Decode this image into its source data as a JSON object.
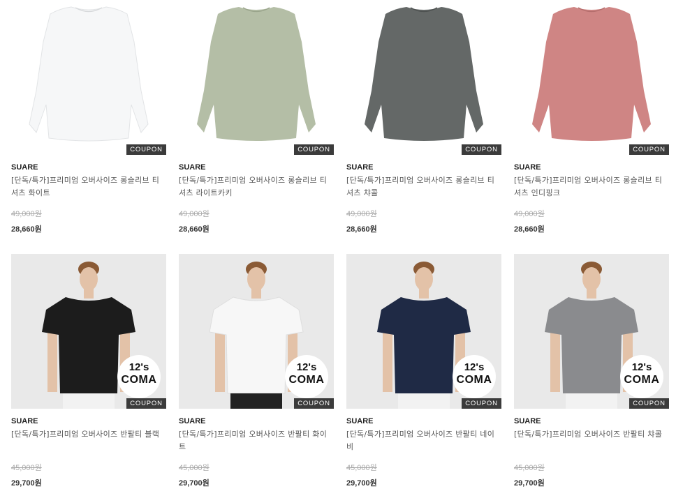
{
  "products": [
    {
      "brand": "SUARE",
      "name": "[단독/특가]프리미엄 오버사이즈 롱슬리브 티셔츠 화이트",
      "original_price": "49,000원",
      "sale_price": "28,660원",
      "coupon": "COUPON",
      "color": "#f6f7f8",
      "type": "longsleeve"
    },
    {
      "brand": "SUARE",
      "name": "[단독/특가]프리미엄 오버사이즈 롱슬리브 티셔츠 라이트카키",
      "original_price": "49,000원",
      "sale_price": "28,660원",
      "coupon": "COUPON",
      "color": "#b4bea6",
      "type": "longsleeve"
    },
    {
      "brand": "SUARE",
      "name": "[단독/특가]프리미엄 오버사이즈 롱슬리브 티셔츠 챠콜",
      "original_price": "49,000원",
      "sale_price": "28,660원",
      "coupon": "COUPON",
      "color": "#646867",
      "type": "longsleeve"
    },
    {
      "brand": "SUARE",
      "name": "[단독/특가]프리미엄 오버사이즈 롱슬리브 티셔츠 인디핑크",
      "original_price": "49,000원",
      "sale_price": "28,660원",
      "coupon": "COUPON",
      "color": "#cf8584",
      "type": "longsleeve"
    },
    {
      "brand": "SUARE",
      "name": "[단독/특가]프리미엄 오버사이즈 반팔티 블랙",
      "original_price": "45,000원",
      "sale_price": "29,700원",
      "coupon": "COUPON",
      "badge_line1": "12's",
      "badge_line2": "COMA",
      "color": "#1c1c1c",
      "type": "shortsleeve"
    },
    {
      "brand": "SUARE",
      "name": "[단독/특가]프리미엄 오버사이즈 반팔티 화이트",
      "original_price": "45,000원",
      "sale_price": "29,700원",
      "coupon": "COUPON",
      "badge_line1": "12's",
      "badge_line2": "COMA",
      "color": "#f7f7f7",
      "type": "shortsleeve"
    },
    {
      "brand": "SUARE",
      "name": "[단독/특가]프리미엄 오버사이즈 반팔티 네이비",
      "original_price": "45,000원",
      "sale_price": "29,700원",
      "coupon": "COUPON",
      "badge_line1": "12's",
      "badge_line2": "COMA",
      "color": "#1f2a45",
      "type": "shortsleeve"
    },
    {
      "brand": "SUARE",
      "name": "[단독/특가]프리미엄 오버사이즈 반팔티 챠콜",
      "original_price": "45,000원",
      "sale_price": "29,700원",
      "coupon": "COUPON",
      "badge_line1": "12's",
      "badge_line2": "COMA",
      "color": "#8a8b8e",
      "type": "shortsleeve"
    }
  ]
}
